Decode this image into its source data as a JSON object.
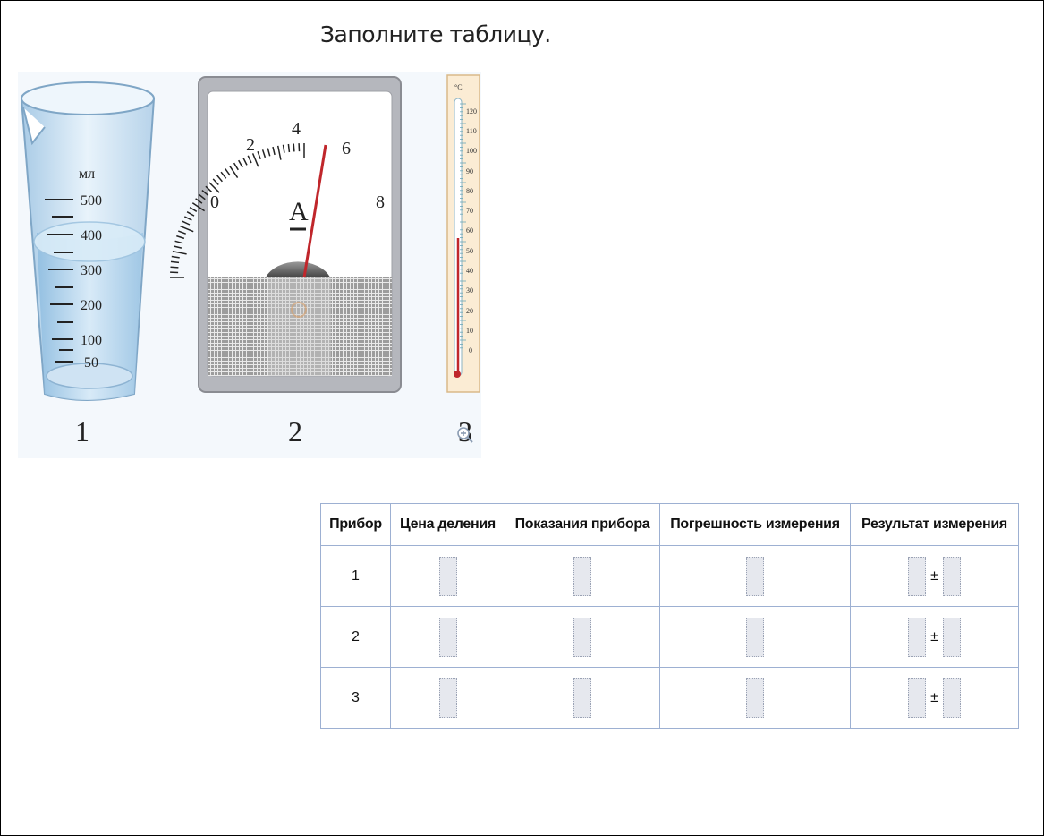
{
  "instruction": "Заполните таблицу.",
  "figure": {
    "labels": [
      "1",
      "2",
      "3"
    ],
    "cylinder": {
      "unit": "мл",
      "scale": [
        "500",
        "400",
        "300",
        "200",
        "100",
        "50"
      ]
    },
    "ammeter": {
      "symbol": "А",
      "scale": [
        "0",
        "2",
        "4",
        "6",
        "8"
      ]
    },
    "thermometer": {
      "unit": "°C",
      "scale": [
        "120",
        "110",
        "100",
        "90",
        "80",
        "70",
        "60",
        "50",
        "40",
        "30",
        "20",
        "10",
        "0"
      ]
    }
  },
  "table": {
    "headers": [
      "Прибор",
      "Цена деления",
      "Показания прибора",
      "Погрешность измерения",
      "Результат измерения"
    ],
    "rows": [
      {
        "device": "1"
      },
      {
        "device": "2"
      },
      {
        "device": "3"
      }
    ],
    "pm_symbol": "±"
  },
  "colors": {
    "table_border": "#9db0d2",
    "input_fill": "#e6e8ee",
    "needle": "#c0262b",
    "mercury": "#c0262b"
  }
}
